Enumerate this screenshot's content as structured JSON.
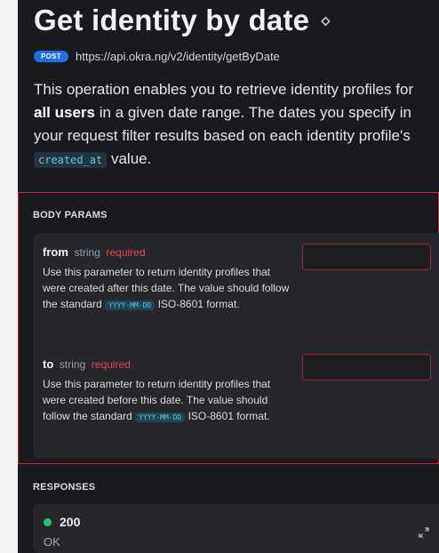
{
  "header": {
    "title": "Get identity by date",
    "method": "POST",
    "url": "https://api.okra.ng/v2/identity/getByDate"
  },
  "description": {
    "part1": "This operation enables you to retrieve identity profiles for ",
    "bold": "all users",
    "part2": " in a given date range. The dates you specify in your request filter results based on each identity profile's ",
    "code": "created_at",
    "part3": " value."
  },
  "body_params": {
    "label": "BODY PARAMS",
    "params": [
      {
        "name": "from",
        "type": "string",
        "required": "required",
        "desc_before": "Use this parameter to return identity profiles that were created after this date. The value should follow the standard ",
        "format_code": "YYYY-MM-DD",
        "desc_after": " ISO-8601 format.",
        "value": ""
      },
      {
        "name": "to",
        "type": "string",
        "required": "required",
        "desc_before": "Use this parameter to return identity profiles that were created before this date. The value should follow the standard ",
        "format_code": "YYYY-MM-DD",
        "desc_after": " ISO-8601 format.",
        "value": ""
      }
    ]
  },
  "responses": {
    "label": "RESPONSES",
    "items": [
      {
        "code": "200",
        "text": "OK",
        "status_color": "#21c46a"
      }
    ]
  },
  "colors": {
    "background": "#181a1f",
    "accent": "#1f6fe0",
    "required": "#e8474b",
    "highlight_border": "#d0202a"
  },
  "icons": {
    "title": "link-icon",
    "expand": "expand-icon"
  }
}
